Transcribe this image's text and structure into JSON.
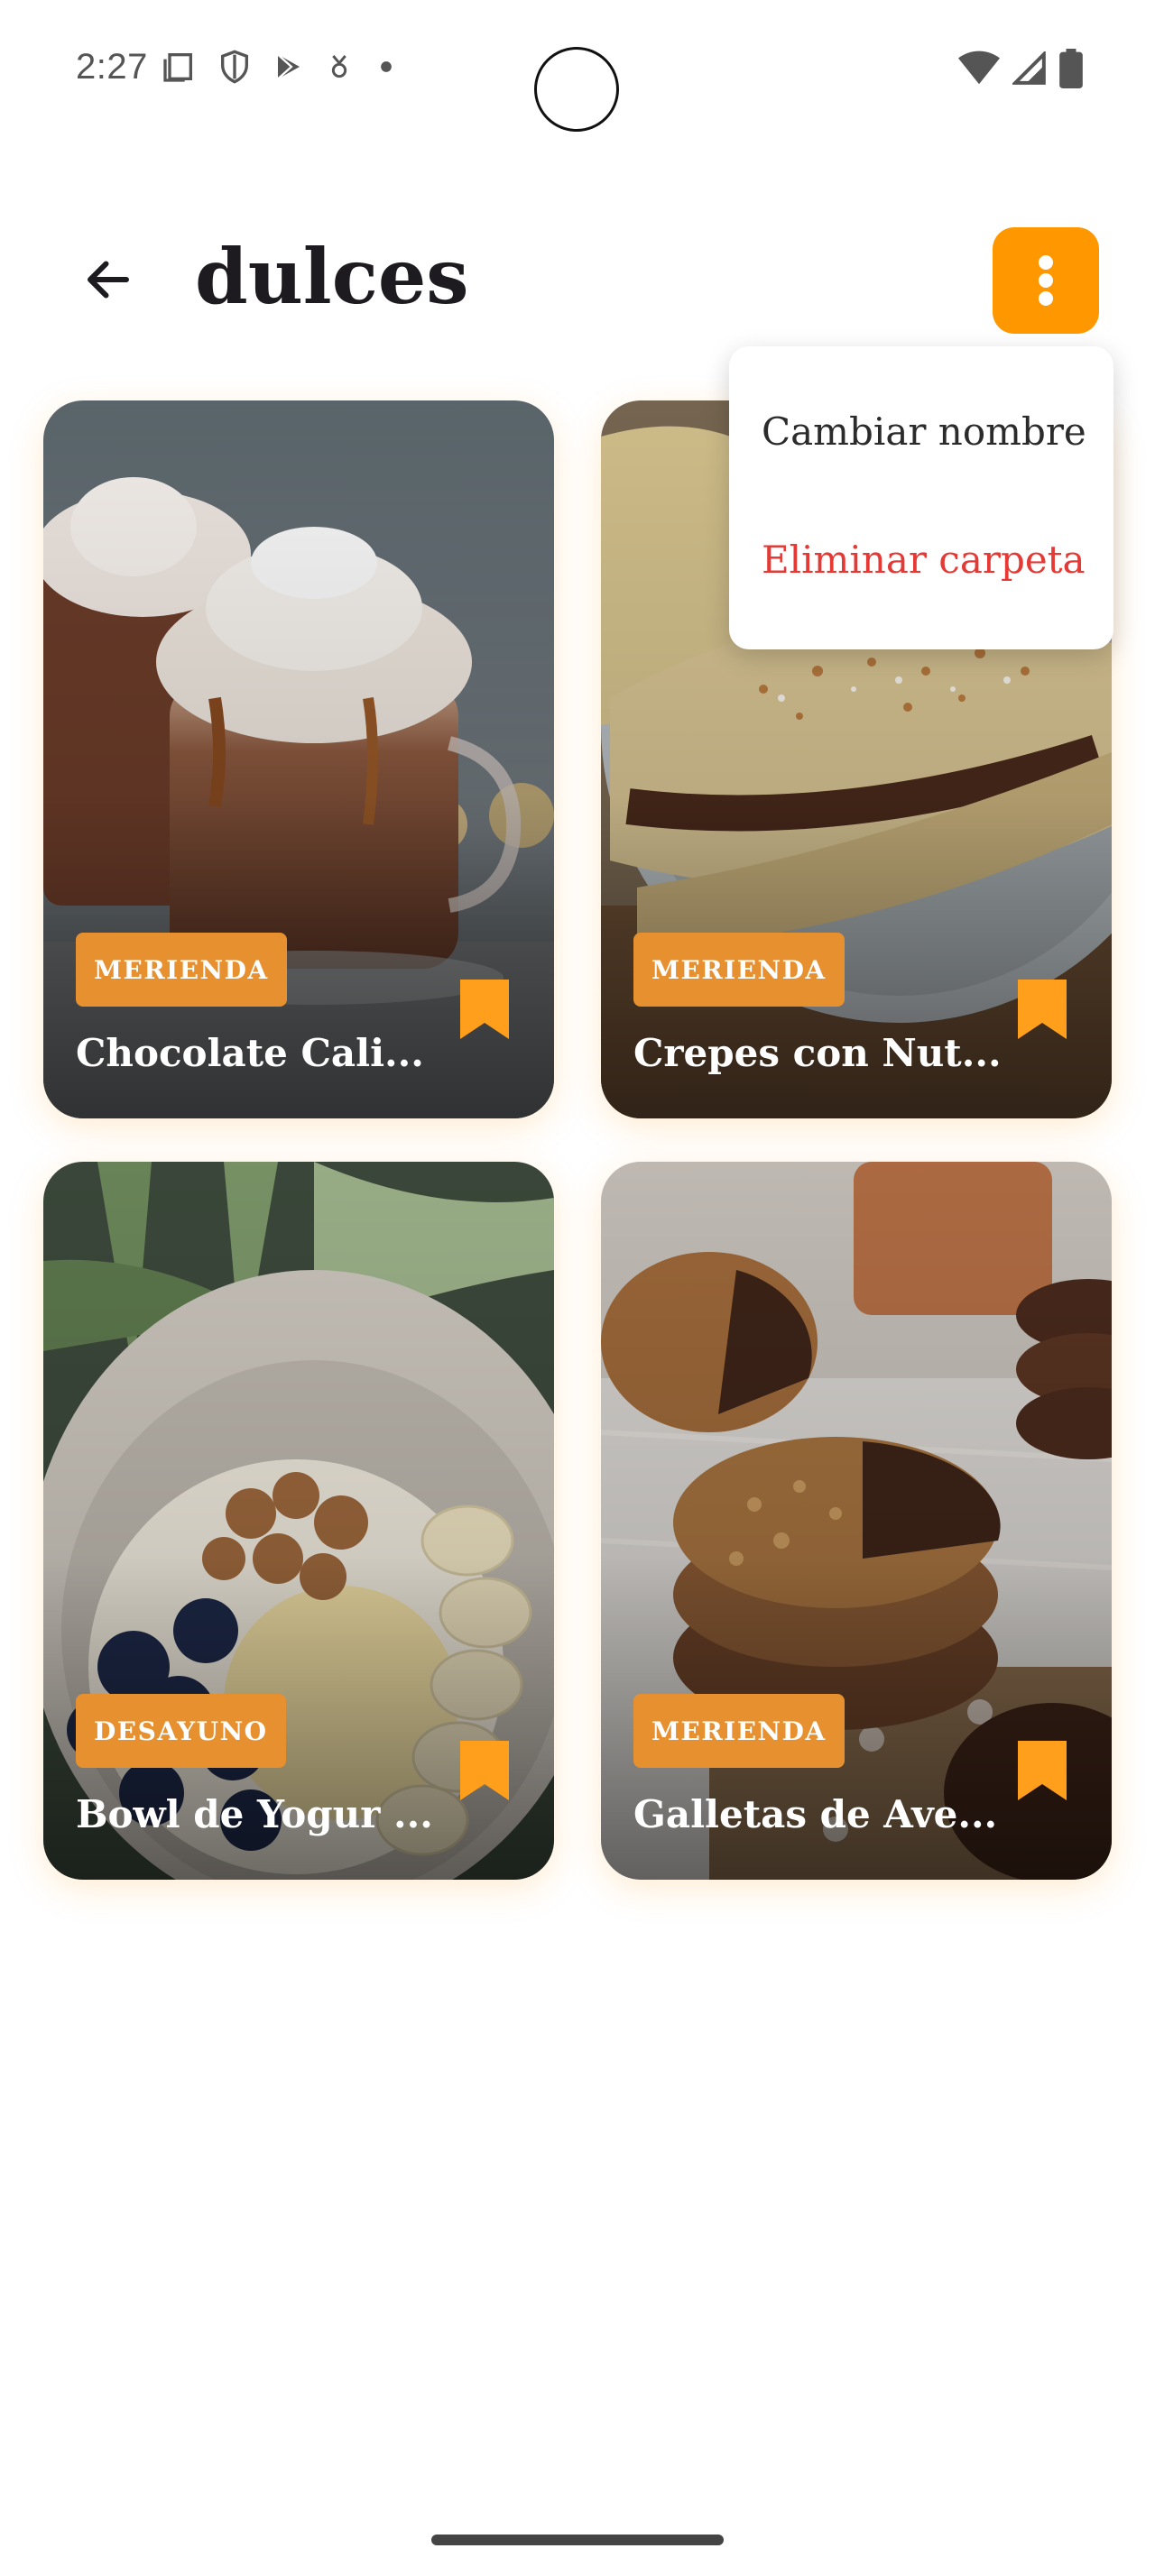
{
  "status_bar": {
    "time": "2:27",
    "icons_left": [
      "screenshot-icon",
      "shield-icon",
      "play-store-icon",
      "vpn-icon",
      "dot-icon"
    ],
    "icons_right": [
      "wifi-icon",
      "cellular-icon",
      "battery-icon"
    ]
  },
  "header": {
    "back_icon": "arrow-back-icon",
    "title": "dulces",
    "more_icon": "more-vertical-icon",
    "accent_color": "#ff9800"
  },
  "menu": {
    "items": [
      {
        "label": "Cambiar nombre",
        "color": "#2b2b2b"
      },
      {
        "label": "Eliminar carpeta",
        "color": "#e53935"
      }
    ]
  },
  "recipes": [
    {
      "tag": "MERIENDA",
      "title": "Chocolate Cali...",
      "image": "hot-chocolate-photo",
      "bookmarked": true
    },
    {
      "tag": "MERIENDA",
      "title": "Crepes con Nut...",
      "image": "crepes-photo",
      "bookmarked": true
    },
    {
      "tag": "DESAYUNO",
      "title": "Bowl de Yogur ...",
      "image": "yogurt-bowl-photo",
      "bookmarked": true
    },
    {
      "tag": "MERIENDA",
      "title": "Galletas de Ave...",
      "image": "oat-cookies-photo",
      "bookmarked": true
    }
  ],
  "colors": {
    "tag_background": "#e7902f",
    "bookmark": "#ff9f1c",
    "delete_text": "#e53935"
  }
}
